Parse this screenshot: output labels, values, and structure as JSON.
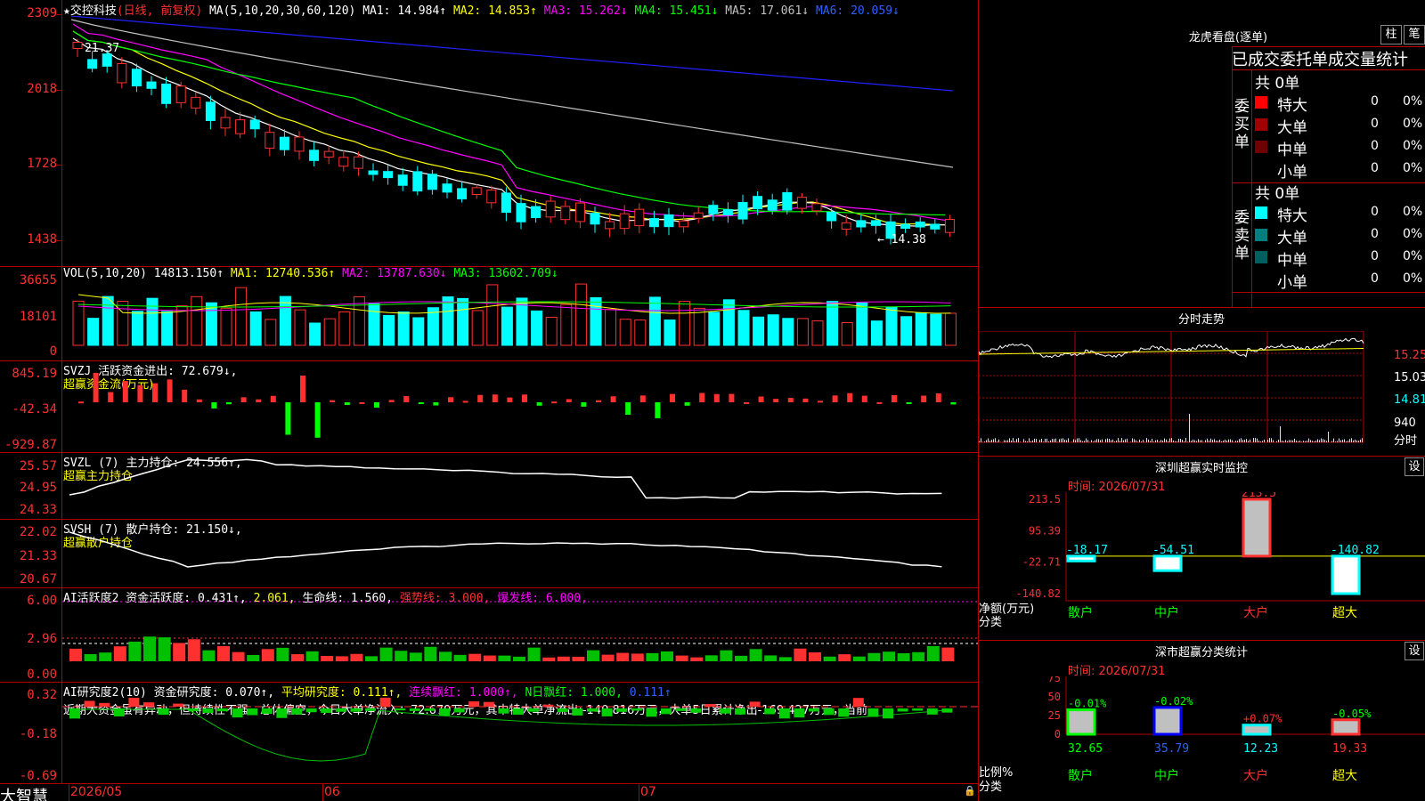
{
  "colors": {
    "up": "#ff3030",
    "down": "#00ffff",
    "grid": "#b00000",
    "bg": "#000000",
    "ma1": "#ffffff",
    "ma2": "#ffff00",
    "ma3": "#ff00ff",
    "ma4": "#00ff00",
    "ma5": "#c0c0c0",
    "ma6": "#2020ff"
  },
  "stock": {
    "star": "★",
    "name": "交控科技",
    "period": "(日线, 前复权)"
  },
  "ma_header": {
    "label": "MA(5,10,20,30,60,120)",
    "ma1": "MA1: 14.984↑",
    "ma2": "MA2: 14.853↑",
    "ma3": "MA3: 15.262↓",
    "ma4": "MA4: 15.451↓",
    "ma5": "MA5: 17.061↓",
    "ma6": "MA6: 20.059↓"
  },
  "price_axis": [
    "2309",
    "2018",
    "1728",
    "1438"
  ],
  "price_marks": {
    "high": "21.37",
    "low": "← 14.38"
  },
  "vol_header": {
    "label": "VOL(5,10,20)",
    "v": "14813.150↑",
    "ma1": "MA1: 12740.536↑",
    "ma2": "MA2: 13787.630↓",
    "ma3": "MA3: 13602.709↓"
  },
  "vol_axis": [
    "36655",
    "18101",
    "0"
  ],
  "svzj": {
    "label": "SVZJ  活跃资金进出: 72.679↓,",
    "sub": "超赢资金流(万元)",
    "axis": [
      "845.19",
      "-42.34",
      "-929.87"
    ]
  },
  "svzl": {
    "label": "SVZL (7) 主力持仓: 24.556↑,",
    "sub": "超赢主力持仓",
    "axis": [
      "25.57",
      "24.95",
      "24.33"
    ]
  },
  "svsh": {
    "label": "SVSH (7) 散户持仓: 21.150↓,",
    "sub": "超赢散户持仓",
    "axis": [
      "22.02",
      "21.33",
      "20.67"
    ]
  },
  "ai1": {
    "label": "AI活跃度2 资金活跃度: 0.431↑,",
    "v2": "2.061,",
    "v3": "生命线: 1.560,",
    "v4": "强势线: 3.000,",
    "v5": "爆发线: 6.000,",
    "axis": [
      "6.00",
      "2.96",
      "0.00"
    ]
  },
  "ai2": {
    "label": "AI研究度2(10) 资金研究度: 0.070↑,",
    "v2": "平均研究度: 0.111↑,",
    "v3": "连续飘红: 1.000↑,",
    "v4": "N日飘红: 1.000,",
    "v5": "0.111↑",
    "note": "近期大资金虽有异动，但持续性不强，总体偏空，今日大单净流入：72.679万元，其中特大单净流出:-140.816万元，大单5日累计净出-169.427万元，当前",
    "axis": [
      "0.32",
      "-0.18",
      "-0.69"
    ]
  },
  "xaxis": {
    "logo": "大智慧",
    "d1": "2026/05",
    "d2": "06",
    "d3": "07"
  },
  "longhu": {
    "title": "龙虎看盘(逐单)",
    "btn1": "柱",
    "btn2": "笔",
    "subtitle": "已成交委托单成交量统计",
    "buy_label": "委买单",
    "sell_label": "委卖单",
    "buy_total": "共 0单",
    "sell_total": "共 0单",
    "buy_rows": [
      {
        "name": "特大",
        "count": "0",
        "pct": "0%",
        "color": "#ff0000"
      },
      {
        "name": "大单",
        "count": "0",
        "pct": "0%",
        "color": "#a00000"
      },
      {
        "name": "中单",
        "count": "0",
        "pct": "0%",
        "color": "#700000"
      },
      {
        "name": "小单",
        "count": "0",
        "pct": "0%",
        "color": ""
      }
    ],
    "sell_rows": [
      {
        "name": "特大",
        "count": "0",
        "pct": "0%",
        "color": "#00ffff"
      },
      {
        "name": "大单",
        "count": "0",
        "pct": "0%",
        "color": "#008080"
      },
      {
        "name": "中单",
        "count": "0",
        "pct": "0%",
        "color": "#006060"
      },
      {
        "name": "小单",
        "count": "0",
        "pct": "0%",
        "color": ""
      }
    ]
  },
  "fenshi": {
    "title": "分时走势",
    "axis": [
      "15.25",
      "15.03",
      "14.81",
      "940"
    ],
    "unit": "分时"
  },
  "monitor": {
    "title": "深圳超赢实时监控",
    "btn": "设",
    "time": "时间: 2026/07/31",
    "axis": [
      "213.5",
      "95.39",
      "-22.71",
      "-140.82"
    ],
    "ylabel": "净额(万元)",
    "xlabel": "分类",
    "bars": [
      {
        "cat": "散户",
        "value": "-18.17"
      },
      {
        "cat": "中户",
        "value": "-54.51"
      },
      {
        "cat": "大户",
        "value": "213.5"
      },
      {
        "cat": "超大",
        "value": "-140.82"
      }
    ]
  },
  "classify": {
    "title": "深市超赢分类统计",
    "btn": "设",
    "time": "时间: 2026/07/31",
    "axis": [
      "75",
      "50",
      "25",
      "0"
    ],
    "ylabel": "比例%",
    "xlabel": "分类",
    "bars": [
      {
        "cat": "散户",
        "pct": "32.65",
        "chg": "-0.01%"
      },
      {
        "cat": "中户",
        "pct": "35.79",
        "chg": "-0.02%"
      },
      {
        "cat": "大户",
        "pct": "12.23",
        "chg": "+0.07%"
      },
      {
        "cat": "超大",
        "pct": "19.33",
        "chg": "-0.05%"
      }
    ]
  }
}
